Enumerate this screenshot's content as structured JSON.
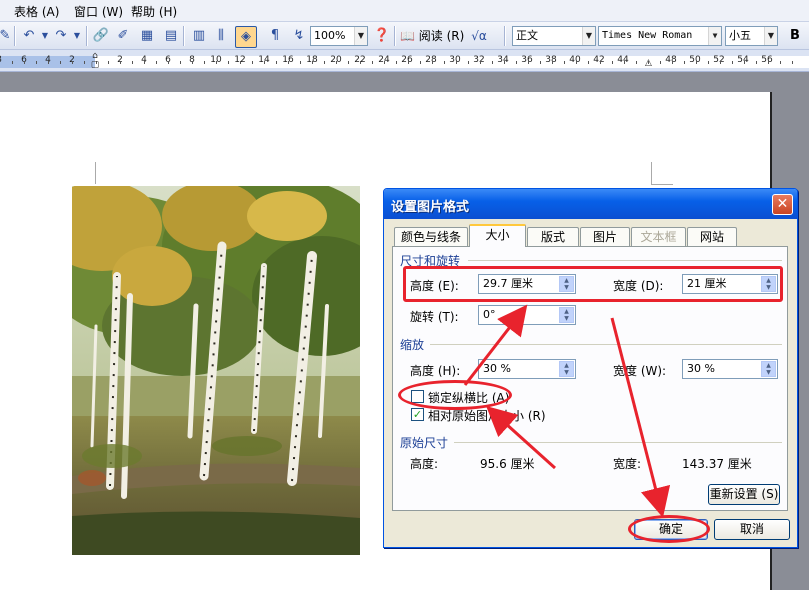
{
  "menu": {
    "items": [
      "表格 (A)",
      "窗口 (W)",
      "帮助 (H)"
    ]
  },
  "toolbar": {
    "zoom": "100%",
    "reading_label": "阅读 (R)",
    "style": "正文",
    "font": "Times New Roman",
    "font_size": "小五"
  },
  "ruler": {
    "left_ticks": [
      "8",
      "6",
      "4",
      "2"
    ],
    "right_ticks": [
      "2",
      "4",
      "6",
      "8",
      "10",
      "12",
      "14",
      "16",
      "18",
      "20",
      "22",
      "24",
      "26",
      "28",
      "30",
      "32",
      "34",
      "36",
      "38",
      "40",
      "42",
      "44",
      "48",
      "50",
      "52",
      "54",
      "56"
    ]
  },
  "dialog": {
    "title": "设置图片格式",
    "tabs": [
      "颜色与线条",
      "大小",
      "版式",
      "图片",
      "文本框",
      "网站"
    ],
    "active_tab": "大小",
    "size_rotate": {
      "heading": "尺寸和旋转",
      "height_label": "高度 (E):",
      "height_value": "29.7 厘米",
      "width_label": "宽度 (D):",
      "width_value": "21 厘米",
      "rotate_label": "旋转 (T):",
      "rotate_value": "0°"
    },
    "scale": {
      "heading": "缩放",
      "height_label": "高度 (H):",
      "height_value": "30 %",
      "width_label": "宽度 (W):",
      "width_value": "30 %",
      "lock_aspect_label": "锁定纵横比 (A)",
      "lock_aspect_checked": false,
      "relative_label": "相对原始图片大小 (R)",
      "relative_checked": true
    },
    "original": {
      "heading": "原始尺寸",
      "height_label": "高度:",
      "height_value": "95.6 厘米",
      "width_label": "宽度:",
      "width_value": "143.37 厘米"
    },
    "reset_label": "重新设置 (S)",
    "ok_label": "确定",
    "cancel_label": "取消"
  },
  "colors": {
    "annotation_red": "#e8232d",
    "dialog_title_blue": "#0a4fd1",
    "section_blue": "#1c3f95"
  }
}
